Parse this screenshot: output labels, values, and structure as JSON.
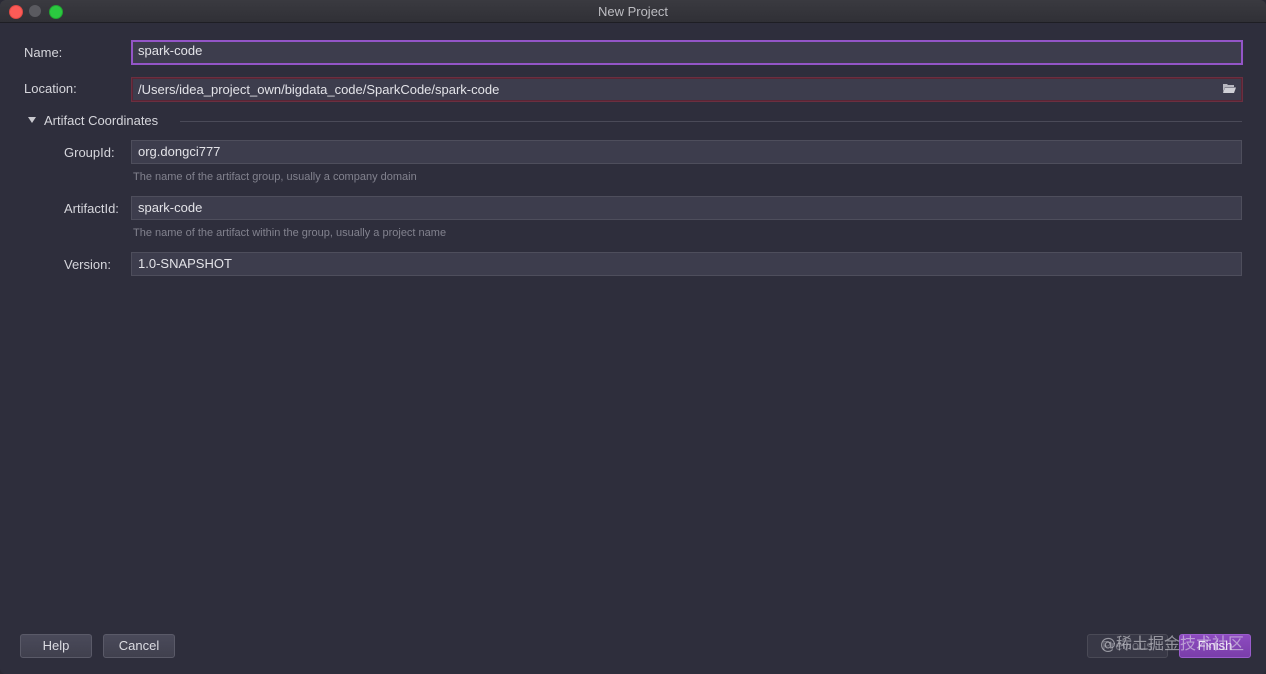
{
  "window": {
    "title": "New Project"
  },
  "form": {
    "name_label": "Name:",
    "name_value": "spark-code",
    "location_label": "Location:",
    "location_value": "/Users/idea_project_own/bigdata_code/SparkCode/spark-code",
    "section_title": "Artifact Coordinates",
    "groupid_label": "GroupId:",
    "groupid_value": "org.dongci777",
    "groupid_hint": "The name of the artifact group, usually a company domain",
    "artifactid_label": "ArtifactId:",
    "artifactid_value": "spark-code",
    "artifactid_hint": "The name of the artifact within the group, usually a project name",
    "version_label": "Version:",
    "version_value": "1.0-SNAPSHOT"
  },
  "buttons": {
    "help": "Help",
    "cancel": "Cancel",
    "previous": "Previous",
    "finish": "Finish"
  },
  "watermark": "@稀土掘金技术社区",
  "icons": {
    "section_toggle": "triangle-down-icon",
    "browse": "folder-open-icon"
  },
  "colors": {
    "accent": "#9355c7",
    "error_border": "#6b2f40",
    "background": "#2e2e3c"
  }
}
